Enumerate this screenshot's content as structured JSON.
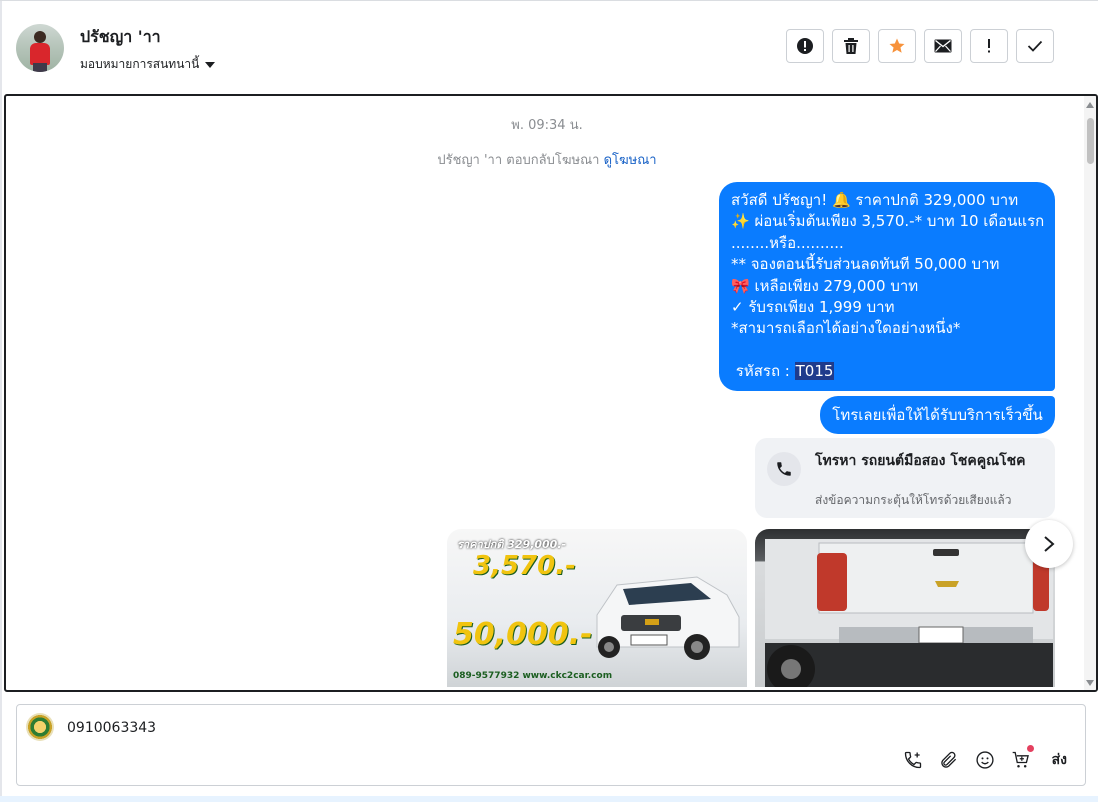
{
  "header": {
    "contact_name": "ปรัชญา 'าา",
    "assign_label": "มอบหมายการสนทนานี้",
    "actions": [
      {
        "name": "spam-button",
        "icon": "exclamation-circle-icon"
      },
      {
        "name": "delete-button",
        "icon": "trash-icon"
      },
      {
        "name": "star-button",
        "icon": "star-icon"
      },
      {
        "name": "mark-unread-button",
        "icon": "envelope-icon"
      },
      {
        "name": "follow-up-button",
        "icon": "exclamation-icon"
      },
      {
        "name": "done-button",
        "icon": "check-icon"
      }
    ]
  },
  "conversation": {
    "timestamp": "พ. 09:34 น.",
    "ad_reply_text": "ปรัชญา 'าา ตอบกลับโฆษณา",
    "ad_reply_link": "ดูโฆษณา",
    "message_lines": [
      "สวัสดี ปรัชญา! 🔔 ราคาปกติ 329,000 บาท",
      "✨ ผ่อนเริ่มต้นเพียง 3,570.-* บาท 10 เดือนแรก",
      "........หรือ..........",
      "** จองตอนนี้รับส่วนลดทันที 50,000 บาท",
      "🎀 เหลือเพียง 279,000 บาท",
      "✓ รับรถเพียง 1,999 บาท",
      "*สามารถเลือกได้อย่างใดอย่างหนึ่ง*",
      ""
    ],
    "code_label": "รหัสรถ :",
    "code_value": "T015",
    "quick_reply": "โทรเลยเพื่อให้ได้รับบริการเร็วขึ้น",
    "call_card": {
      "title": "โทรหา รถยนต์มือสอง โชคคูณโชค",
      "subtitle": "ส่งข้อความกระตุ้นให้โทรด้วยเสียงแล้ว"
    },
    "promo_image": {
      "price_text": "ราคาปกติ 329,000.-",
      "monthly": "3,570.-",
      "discount": "50,000.-",
      "footer": "089-9577932 www.ckc2car.com"
    }
  },
  "composer": {
    "input_value": "0910063343",
    "send_label": "ส่ง"
  },
  "colors": {
    "accent": "#0a7cff",
    "star": "#f7923b"
  }
}
